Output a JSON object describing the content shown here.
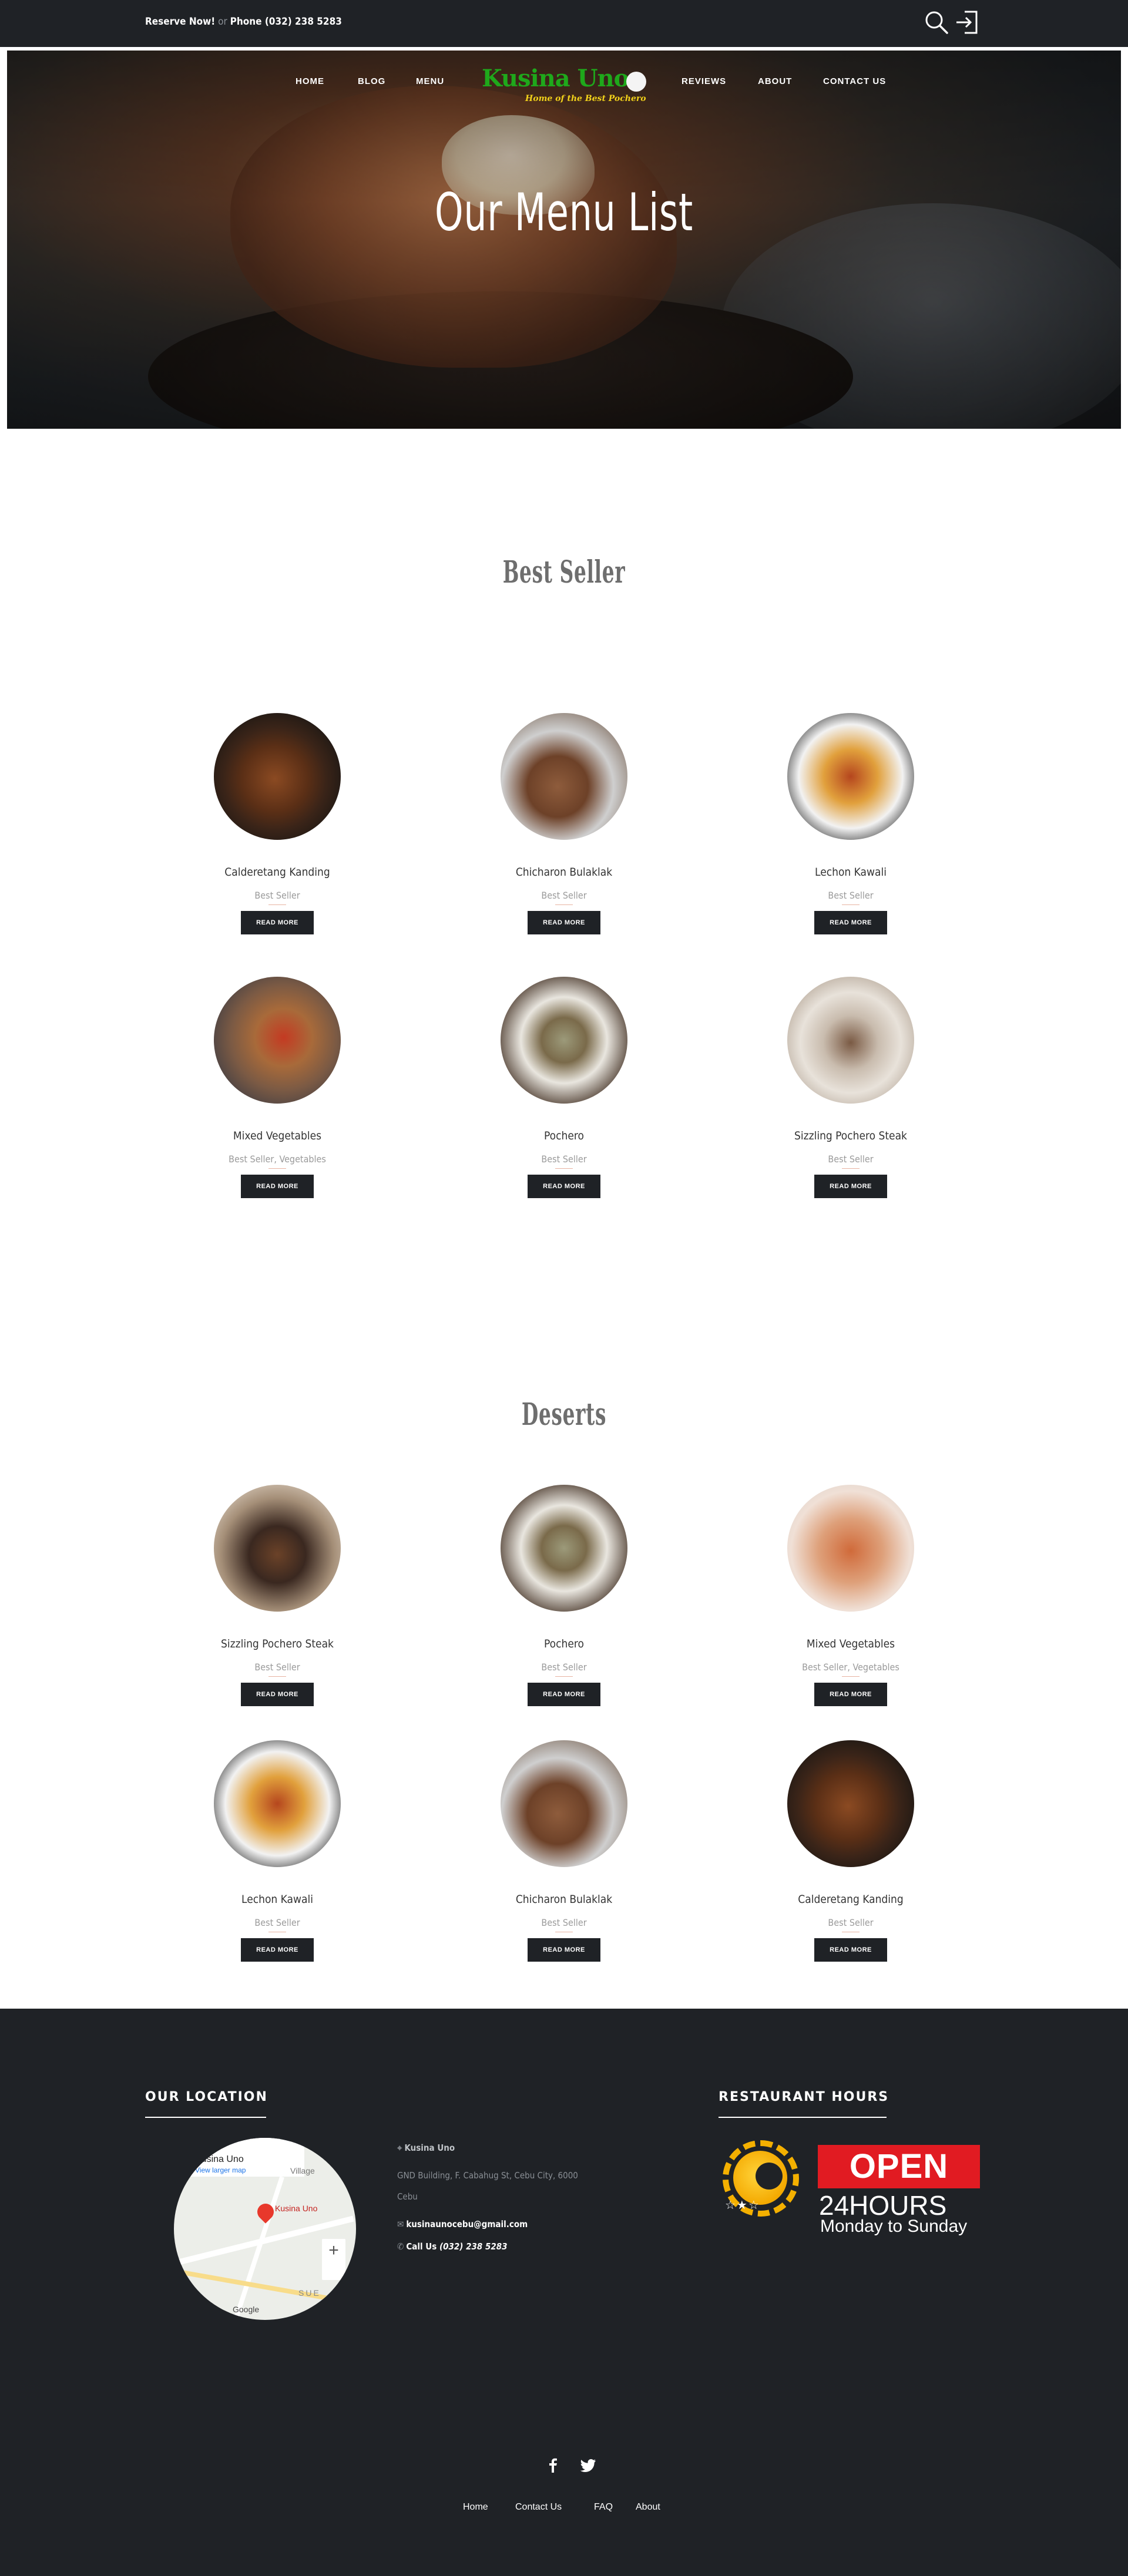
{
  "topbar": {
    "reserve": "Reserve Now!",
    "or": "or",
    "phone_label": "Phone (032) 238 5283"
  },
  "nav": {
    "home": "HOME",
    "blog": "BLOG",
    "menu": "MENU",
    "reviews": "REVIEWS",
    "about": "ABOUT",
    "contact": "CONTACT US"
  },
  "logo": {
    "brand": "Kusina Uno",
    "tagline": "Home of the Best Pochero"
  },
  "hero": {
    "title": "Our Menu List"
  },
  "best_seller": {
    "title": "Best Seller",
    "items": [
      {
        "name": "Calderetang Kanding",
        "category": "Best Seller",
        "button": "READ MORE"
      },
      {
        "name": "Chicharon Bulaklak",
        "category": "Best Seller",
        "button": "READ MORE"
      },
      {
        "name": "Lechon Kawali",
        "category": "Best Seller",
        "button": "READ MORE"
      },
      {
        "name": "Mixed Vegetables",
        "category": "Best Seller, Vegetables",
        "button": "READ MORE"
      },
      {
        "name": "Pochero",
        "category": "Best Seller",
        "button": "READ MORE"
      },
      {
        "name": "Sizzling Pochero Steak",
        "category": "Best Seller",
        "button": "READ MORE"
      }
    ]
  },
  "deserts": {
    "title": "Deserts",
    "items": [
      {
        "name": "Sizzling Pochero Steak",
        "category": "Best Seller",
        "button": "READ MORE"
      },
      {
        "name": "Pochero",
        "category": "Best Seller",
        "button": "READ MORE"
      },
      {
        "name": "Mixed Vegetables",
        "category": "Best Seller, Vegetables",
        "button": "READ MORE"
      },
      {
        "name": "Lechon Kawali",
        "category": "Best Seller",
        "button": "READ MORE"
      },
      {
        "name": "Chicharon Bulaklak",
        "category": "Best Seller",
        "button": "READ MORE"
      },
      {
        "name": "Calderetang Kanding",
        "category": "Best Seller",
        "button": "READ MORE"
      }
    ]
  },
  "footer": {
    "location_title": "OUR LOCATION",
    "hours_title": "RESTAURANT HOURS",
    "map": {
      "place": "Kusina Uno",
      "view_larger": "View larger map",
      "pin_label": "Kusina Uno",
      "village": "Village",
      "area": "SUE",
      "google": "Google"
    },
    "contact": {
      "name": "Kusina Uno",
      "address": "GND Building, F. Cabahug St, Cebu City, 6000 Cebu",
      "email": "kusinaunocebu@gmail.com",
      "call_label": "Call Us",
      "phone": "(032) 238 5283"
    },
    "open_sign": {
      "open": "OPEN",
      "hours": "24HOURS",
      "days": "Monday to Sunday"
    },
    "links": {
      "home": "Home",
      "contact": "Contact Us",
      "faq": "FAQ",
      "about": "About"
    }
  }
}
